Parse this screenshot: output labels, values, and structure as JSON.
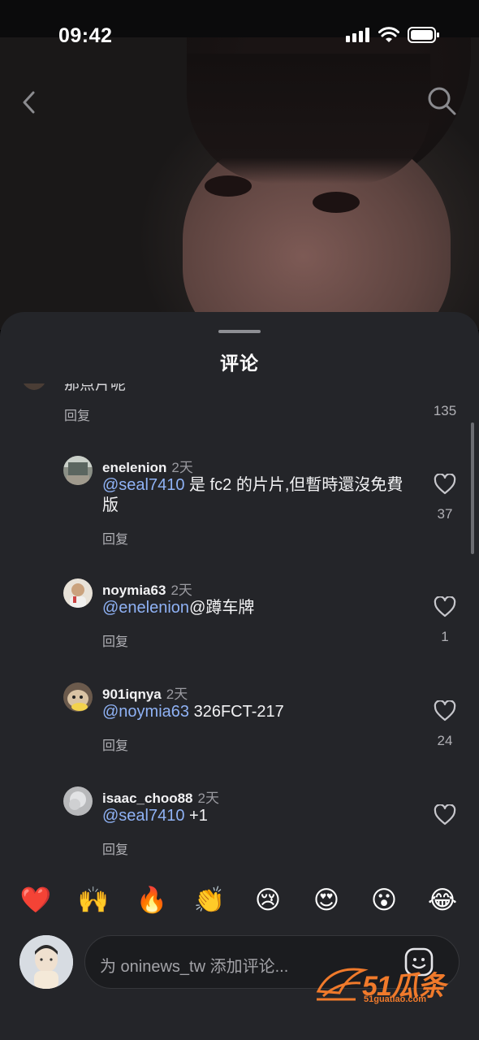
{
  "status_bar": {
    "time": "09:42"
  },
  "sheet": {
    "title": "评论"
  },
  "partial_comment": {
    "text": "那点片呢",
    "reply": "回复",
    "likes": "135"
  },
  "comments": [
    {
      "username": "enelenion",
      "time": "2天",
      "mention": "@seal7410",
      "text": " 是 fc2 的片片,但暫時還沒免費版",
      "reply": "回复",
      "likes": "37"
    },
    {
      "username": "noymia63",
      "time": "2天",
      "mention": "@enelenion",
      "text": "@蹲车牌",
      "reply": "回复",
      "likes": "1"
    },
    {
      "username": "901iqnya",
      "time": "2天",
      "mention": "@noymia63",
      "text": " 326FCT-217",
      "reply": "回复",
      "likes": "24"
    },
    {
      "username": "isaac_choo88",
      "time": "2天",
      "mention": "@seal7410",
      "text": " +1",
      "reply": "回复",
      "likes": ""
    }
  ],
  "emoji_bar": [
    "❤️",
    "🙌",
    "🔥",
    "👏",
    "😢",
    "😍",
    "😮",
    "😂"
  ],
  "input": {
    "placeholder": "为 oninews_tw 添加评论..."
  },
  "watermark": {
    "brand": "51瓜条",
    "domain": "51guatiao.com"
  },
  "colors": {
    "sheet_bg": "#242529",
    "mention": "#8fb2f5",
    "watermark": "#f07a2b"
  }
}
